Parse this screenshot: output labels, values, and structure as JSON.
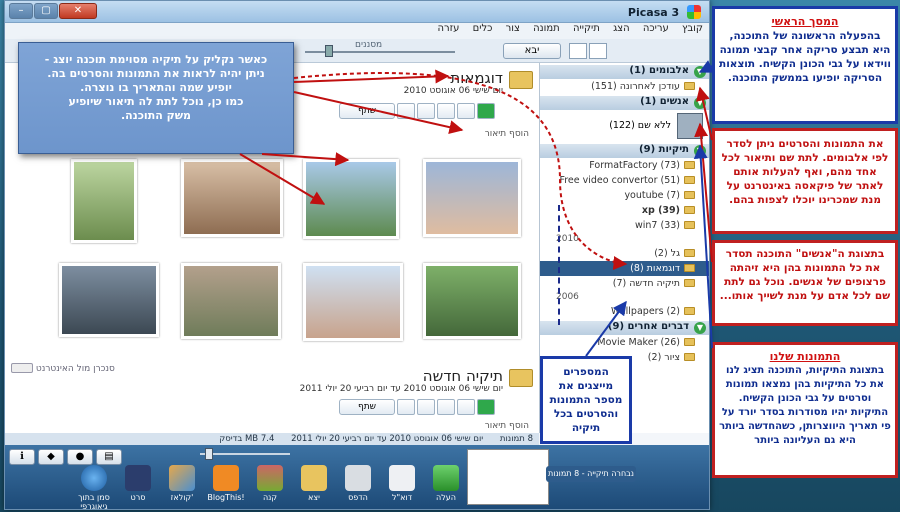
{
  "window": {
    "title": "Picasa 3",
    "controls": {
      "close": "✕",
      "maximize": "▢",
      "minimize": "–"
    }
  },
  "menu": [
    "קובץ",
    "עריכה",
    "הצג",
    "תיקייה",
    "תמונה",
    "צור",
    "כלים",
    "עזרה"
  ],
  "toolbar": {
    "import_label": "יבא",
    "zoom_label": "מסננים"
  },
  "library": {
    "albums": {
      "label": "אלבומים (1)",
      "items": [
        "עודכן לאחרונה (151)"
      ]
    },
    "people": {
      "label": "אנשים (1)",
      "items": [
        "ללא שם (122)"
      ]
    },
    "folders": {
      "label": "תיקיות (9)",
      "items": [
        "FormatFactory (73)",
        "Free video convertor (51)",
        "youtube (7)",
        "xp (39)",
        "win7 (33)",
        "2010",
        "גל (2)",
        "דוגמאות (8)",
        "תיקיה חדשה (7)",
        "2006",
        "Wallpapers (2)"
      ]
    },
    "others": {
      "label": "דברים אחרים (9)",
      "items": [
        "Movie Maker (26)",
        "ציור (2)"
      ]
    }
  },
  "content": {
    "folder1": {
      "title": "דוגמאות",
      "date": "יום שישי 06 אוגוסט 2010",
      "share": "שתף",
      "add_desc": "הוסף תיאור"
    },
    "folder2": {
      "title": "תיקיה חדשה",
      "date": "יום שישי 06 אוגוסט 2010 עד יום רביעי 20 יולי 2011",
      "share": "שתף",
      "add_desc": "הוסף תיאור"
    },
    "sync_label": "סנכרן מול האינטרנט"
  },
  "status": {
    "count": "8 תמונות",
    "range": "יום שישי 06 אוגוסט 2010 עד יום רביעי 20 יולי 2011",
    "size": "7.4 MB בדיסק"
  },
  "tray": {
    "held_caption": "נבחרה תיקייה - 8 תמונות",
    "tools": [
      "סמן בתוך גיאוגרפי",
      "סרט",
      "קולאז'",
      "BlogThis!",
      "קנה",
      "יצא",
      "הדפס",
      "דוא\"ל",
      "העלה"
    ]
  },
  "notes": {
    "top": [
      "כאשר נקליק על תיקיה מסוימת תוכנה יוצג -",
      "ניתן יהיה לראות את התמונות והסרטים בה.",
      "יופיע שמה והתאריך בו נוצרה.",
      "כמו כן, נוכל לתת לה תיאור שיופיע",
      "משק התוכנה."
    ],
    "main_head": "המסך הראשי",
    "main": "בהפעלה הראשונה של התוכנה, היא תבצע סריקה אחר קבצי תמונה ווידאו על גבי הכונן הקשיח. תוצאות הסריקה יופיעו בממשק התוכנה.",
    "albums": "את התמונות והסרטים ניתן לסדר לפי אלבומים. לתת שם ותיאור לכל אחד מהם, ואף להעלות אותם לאתר של פיקאסה באינטרנט על מנת שמכרינו יוכלו לצפות בהם.",
    "people": "בתצוגת ה\"אנשים\" התוכנה תסדר את כל התמונות בהן היא זיהתה פרצופים של אנשים. נוכל גם לתת שם לכל אדם על מנת לשייך אותו...",
    "ours_head": "התמונות שלנו",
    "ours": "בתצוגת התיקיות, התוכנה תציג לנו את כל התיקיות בהן נמצאו תמונות וסרטים על גבי הכונן הקשיח. התיקיות יהיו מסודרות בסדר יורד על פי תאריך היווצרותן, כשהחדשה ביותר היא גם העליונה ביותר",
    "nums": "המספרים מייצגים את מספר התמונות והסרטים בכל תיקיה"
  }
}
